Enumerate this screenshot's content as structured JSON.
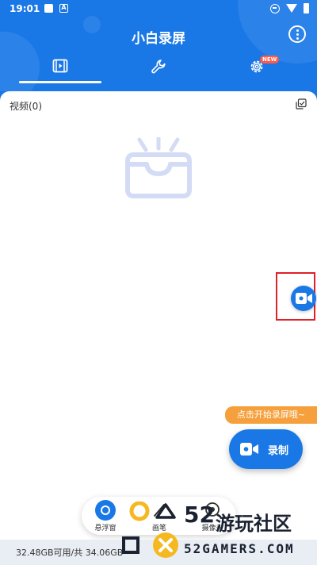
{
  "status_bar": {
    "time": "19:01",
    "left_icon_letter": "A"
  },
  "header": {
    "title": "小白录屏"
  },
  "tabs": [
    {
      "name": "videos",
      "icon": "video-icon",
      "active": true
    },
    {
      "name": "tools",
      "icon": "wrench-icon",
      "active": false
    },
    {
      "name": "settings",
      "icon": "gear-icon",
      "active": false,
      "badge": "NEW"
    }
  ],
  "video_list": {
    "count_label": "视频(0)"
  },
  "float_button": {
    "icon": "video-camera-icon",
    "highlight_color": "#e0202a"
  },
  "record": {
    "tooltip": "点击开始录屏哦~",
    "label": "录制"
  },
  "toolbar": {
    "items": [
      {
        "label": "悬浮窗",
        "icon": "floating-window-icon"
      },
      {
        "label": "画笔",
        "icon": "brush-icon"
      },
      {
        "label": "摄像头",
        "icon": "camera-icon"
      }
    ]
  },
  "storage": {
    "text": "32.48GB可用/共 34.06GB"
  },
  "watermark": {
    "number": "52",
    "cn_text": "游玩社区",
    "en_text": "52GAMERS.COM"
  },
  "colors": {
    "primary": "#1a78e6",
    "accent_orange": "#f5a03c",
    "badge_red": "#ff5a4a"
  }
}
